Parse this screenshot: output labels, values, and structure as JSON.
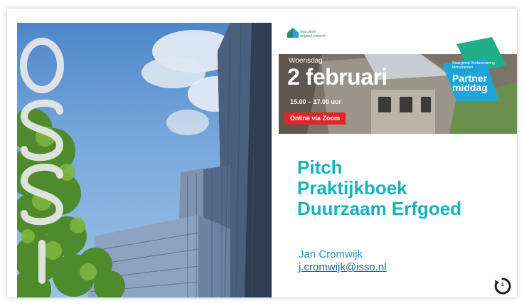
{
  "slide": {
    "logo_letters": "ISSO",
    "banner": {
      "logo_text": "duurzaam erfgoed netwerk",
      "day": "Woensdag",
      "date": "2 februari",
      "time": "15.00 – 17.00 uur",
      "zoom_label": "Online via Zoom",
      "partner_small": "Stuurgroep Verduurzaming Monumenten",
      "partner_big_1": "Partner",
      "partner_big_2": "middag"
    },
    "title_lines": [
      "Pitch",
      "Praktijkboek",
      "Duurzaam Erfgoed"
    ],
    "author": "Jan Cromwijk",
    "email": "j.cromwijk@isso.nl",
    "page_number": "1"
  },
  "colors": {
    "title": "#14b3c2",
    "author": "#2b8fc7",
    "email": "#1f5ea8",
    "zoom": "#e0262b",
    "partner_green": "#1fae8a",
    "partner_blue": "#1fa4d8"
  }
}
